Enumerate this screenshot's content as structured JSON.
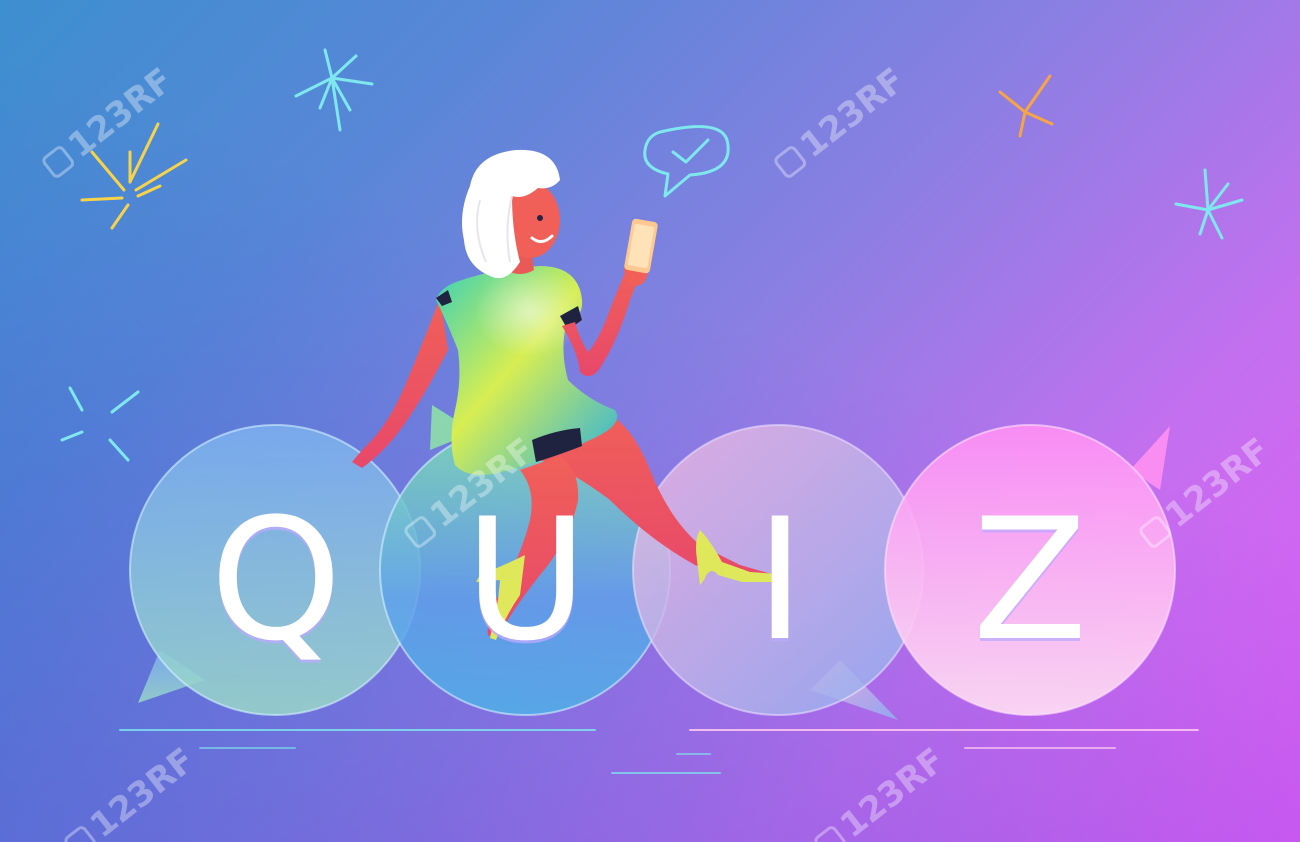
{
  "title": {
    "letters": [
      "Q",
      "U",
      "I",
      "Z"
    ]
  },
  "watermark": {
    "text": "123RF"
  },
  "colors": {
    "background_start": "#3d8fd0",
    "background_end": "#e05bf6",
    "skin": "#ee5a55",
    "dress": "#9fe070",
    "hair": "#ffffff",
    "accent_yellow": "#f7d34a",
    "accent_cyan": "#7fe8ee"
  },
  "icons": [
    "chat-check-icon",
    "sparkle-icon",
    "smartphone-icon"
  ]
}
